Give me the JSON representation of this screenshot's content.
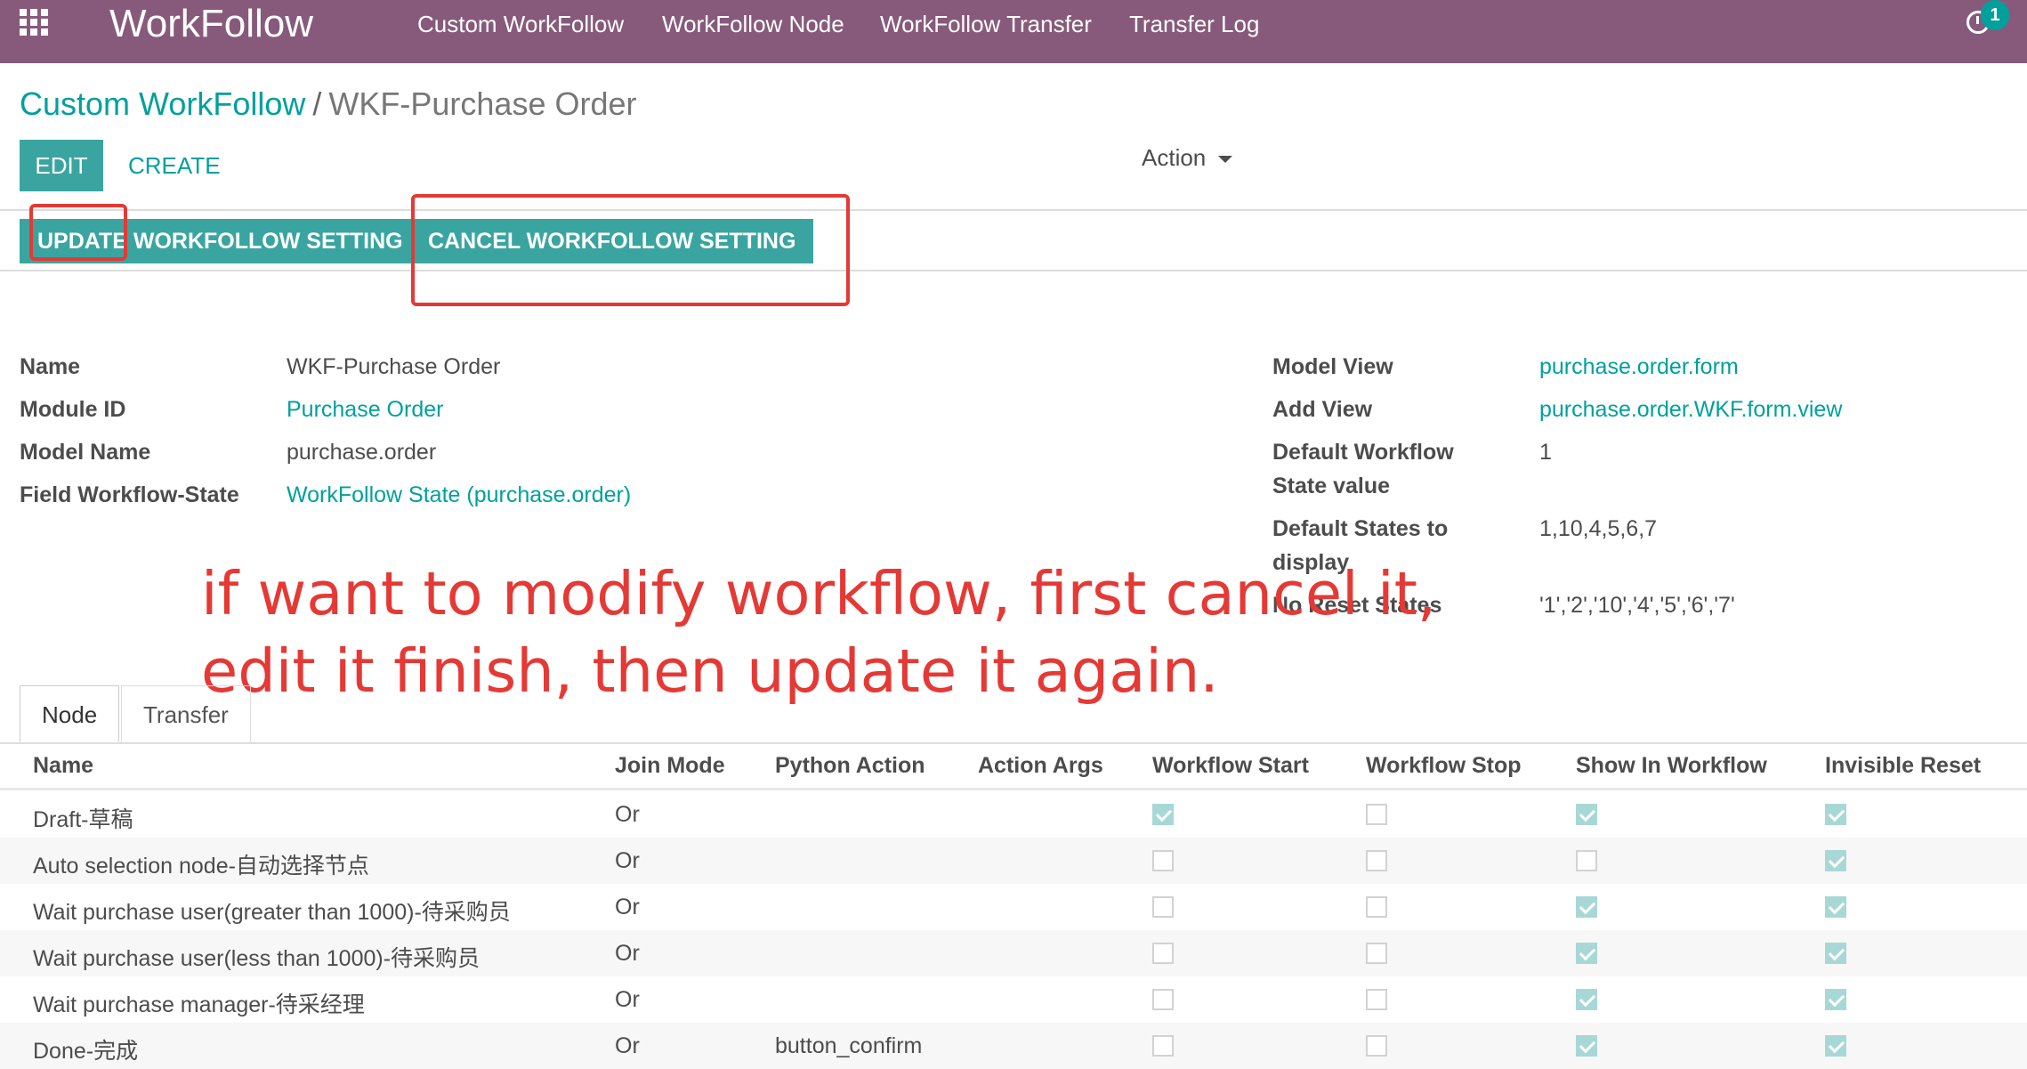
{
  "topbar": {
    "app_title": "WorkFollow",
    "menu": [
      "Custom WorkFollow",
      "WorkFollow Node",
      "WorkFollow Transfer",
      "Transfer Log"
    ],
    "activity_count": "1"
  },
  "breadcrumb": {
    "parent": "Custom WorkFollow",
    "separator": "/",
    "current": "WKF-Purchase Order"
  },
  "toolbar": {
    "edit_label": "EDIT",
    "create_label": "CREATE",
    "action_label": "Action"
  },
  "header_buttons": {
    "update_label": "UPDATE WORKFOLLOW SETTING",
    "cancel_label": "CANCEL WORKFOLLOW SETTING"
  },
  "form": {
    "left": {
      "name_label": "Name",
      "name_value": "WKF-Purchase Order",
      "module_label": "Module ID",
      "module_value": "Purchase Order",
      "model_name_label": "Model Name",
      "model_name_value": "purchase.order",
      "field_state_label": "Field Workflow-State",
      "field_state_value": "WorkFollow State (purchase.order)"
    },
    "right": {
      "model_view_label": "Model View",
      "model_view_value": "purchase.order.form",
      "add_view_label": "Add View",
      "add_view_value": "purchase.order.WKF.form.view",
      "default_state_label_1": "Default Workflow",
      "default_state_label_2": "State value",
      "default_state_value": "1",
      "default_states_label_1": "Default States to",
      "default_states_label_2": "display",
      "default_states_value": "1,10,4,5,6,7",
      "no_reset_label": "No Reset States",
      "no_reset_value": "'1','2','10','4','5','6','7'"
    }
  },
  "annotation": {
    "line1": "if want to modify workflow, first cancel it,",
    "line2": "edit it finish, then update it again."
  },
  "tabs": [
    "Node",
    "Transfer"
  ],
  "table": {
    "columns": [
      "Name",
      "Join Mode",
      "Python Action",
      "Action Args",
      "Workflow Start",
      "Workflow Stop",
      "Show In Workflow",
      "Invisible Reset"
    ],
    "rows": [
      {
        "name": "Draft-草稿",
        "join": "Or",
        "python": "",
        "args": "",
        "start": true,
        "stop": false,
        "show": true,
        "invisible": true
      },
      {
        "name": "Auto selection node-自动选择节点",
        "join": "Or",
        "python": "",
        "args": "",
        "start": false,
        "stop": false,
        "show": false,
        "invisible": true
      },
      {
        "name": "Wait purchase user(greater than 1000)-待采购员",
        "join": "Or",
        "python": "",
        "args": "",
        "start": false,
        "stop": false,
        "show": true,
        "invisible": true
      },
      {
        "name": "Wait purchase user(less than 1000)-待采购员",
        "join": "Or",
        "python": "",
        "args": "",
        "start": false,
        "stop": false,
        "show": true,
        "invisible": true
      },
      {
        "name": "Wait purchase manager-待采经理",
        "join": "Or",
        "python": "",
        "args": "",
        "start": false,
        "stop": false,
        "show": true,
        "invisible": true
      },
      {
        "name": "Done-完成",
        "join": "Or",
        "python": "button_confirm",
        "args": "",
        "start": false,
        "stop": false,
        "show": true,
        "invisible": true
      }
    ]
  },
  "colors": {
    "brand": "#875a7b",
    "accent": "#00a09d",
    "annotation": "#e53935"
  }
}
